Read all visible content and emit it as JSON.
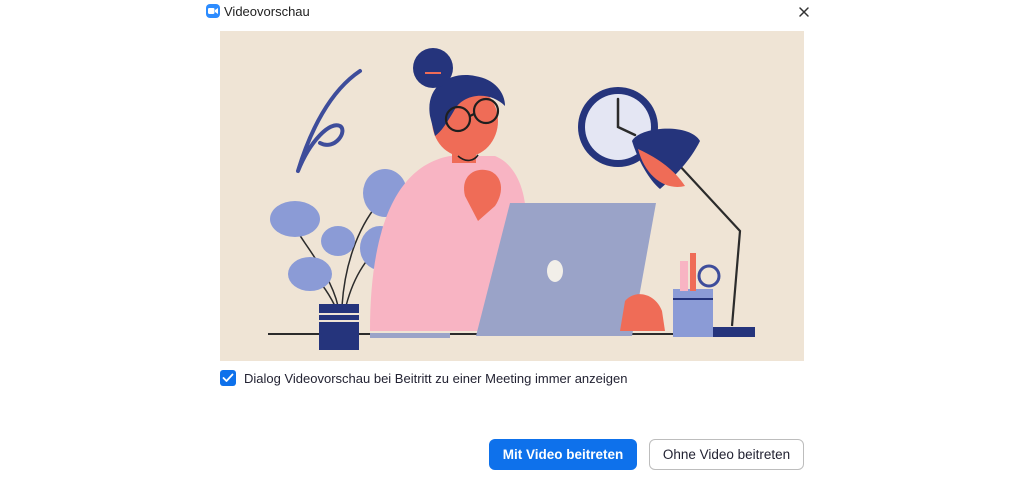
{
  "window": {
    "title": "Videovorschau",
    "app_icon": "zoom-camera-icon",
    "close_icon": "close-icon"
  },
  "preview": {
    "illustration": "person-at-laptop-illustration",
    "background_color": "#EFE4D5"
  },
  "options": {
    "show_preview_checked": true,
    "show_preview_label": "Dialog Videovorschau bei Beitritt zu einer Meeting immer anzeigen"
  },
  "actions": {
    "join_with_video_label": "Mit Video beitreten",
    "join_without_video_label": "Ohne Video beitreten"
  },
  "colors": {
    "accent": "#0E71EB",
    "zoom_blue": "#2D8CFF"
  }
}
